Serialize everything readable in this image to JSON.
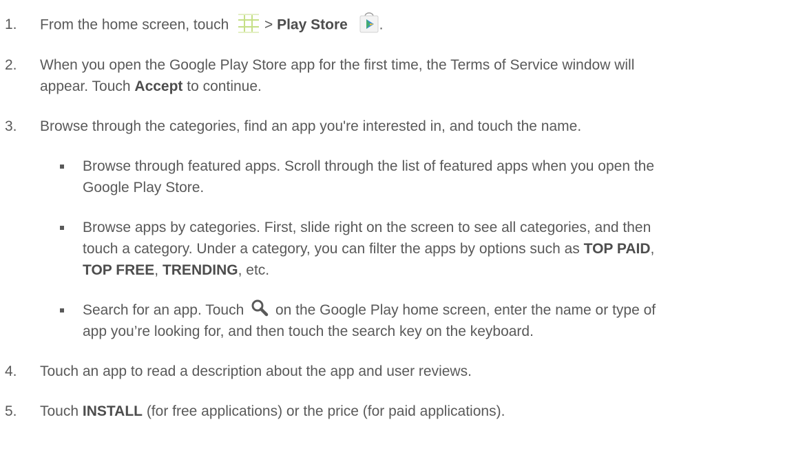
{
  "steps": [
    {
      "num": "1.",
      "prefix": "From the home screen, touch",
      "sep": " > ",
      "bold": "Play Store",
      "suffix": "."
    },
    {
      "num": "2.",
      "line1": "When you open the Google Play Store app for the first time, the Terms of Service window will",
      "line2_prefix": "appear. Touch ",
      "bold": "Accept",
      "line2_suffix": " to continue."
    },
    {
      "num": "3.",
      "text": "Browse through the categories, find an app you're interested in, and touch the name."
    },
    {
      "num": "4.",
      "text": "Touch an app to read a description about the app and user reviews."
    },
    {
      "num": "5.",
      "prefix": "Touch ",
      "bold": "INSTALL",
      "suffix": " (for free applications) or the price (for paid applications)."
    }
  ],
  "bullets": [
    {
      "line1": "Browse through featured apps. Scroll through the list of featured apps when you open the",
      "line2": "Google Play Store."
    },
    {
      "line1": "Browse apps by categories. First, slide right on the screen to see all categories, and then",
      "line2_prefix": "touch a category. Under a category, you can filter the apps by options such as ",
      "bold1": "TOP PAID",
      "comma1": ",",
      "bold2": "TOP FREE",
      "comma2": ", ",
      "bold3": "TRENDING",
      "line3_suffix": ", etc."
    },
    {
      "line1_prefix": "Search for an app. Touch ",
      "line1_suffix": " on the Google Play home screen, enter the name or type of",
      "line2": "app you’re looking for, and then touch the search key on the keyboard."
    }
  ],
  "icons": {
    "apps": "apps-grid-icon",
    "store": "play-store-icon",
    "search": "search-icon"
  },
  "colors": {
    "text": "#595959",
    "apps_icon": "#c8e08a",
    "store_play": "#3b8ed8"
  }
}
